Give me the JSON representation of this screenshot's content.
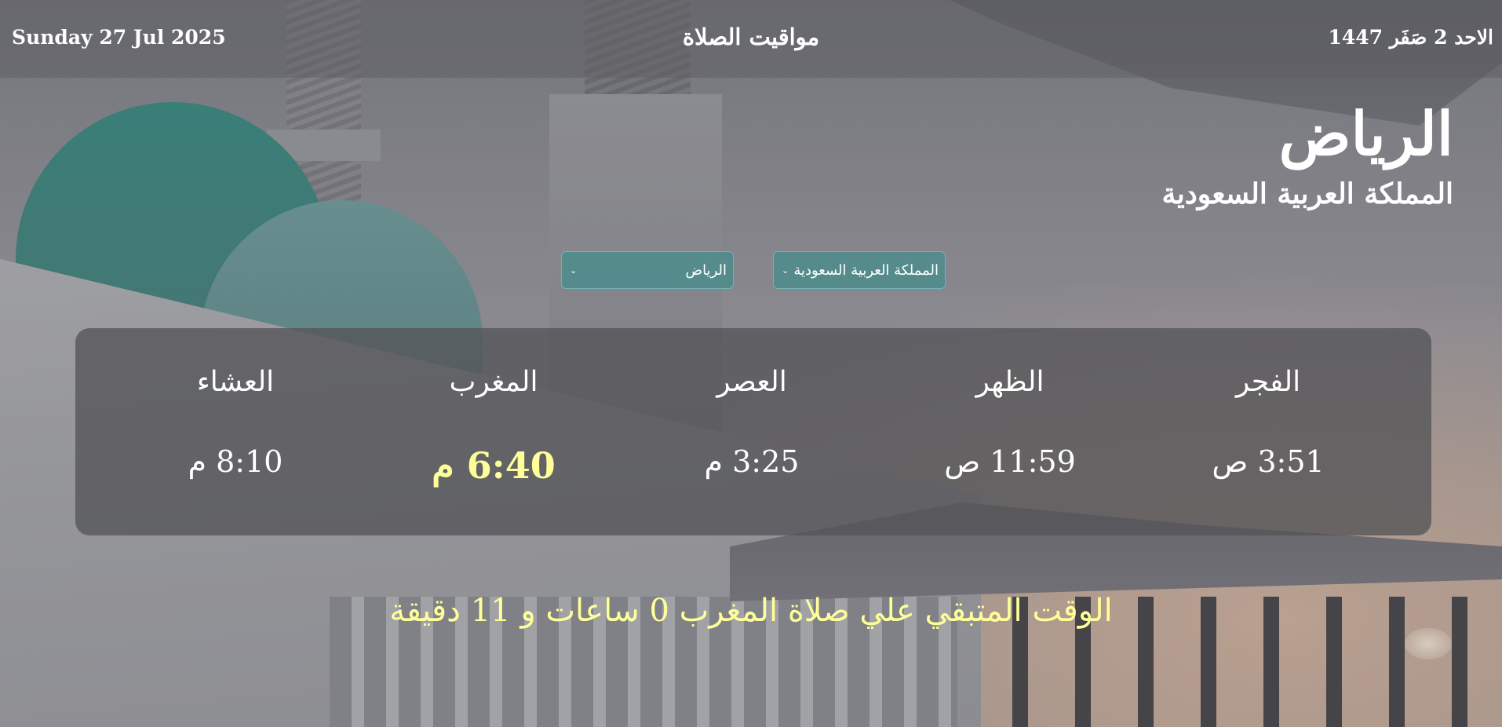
{
  "header": {
    "gregorian_date": "Sunday 27 Jul 2025",
    "title": "مواقيت الصلاة",
    "hijri_date": "الاحد 2 صَفَر 1447"
  },
  "location": {
    "city": "الرياض",
    "country": "المملكة العربية السعودية"
  },
  "selectors": {
    "country_value": "المملكة العربية السعودية",
    "city_value": "الرياض"
  },
  "prayers": [
    {
      "name": "الفجر",
      "time": "3:51 ص"
    },
    {
      "name": "الظهر",
      "time": "11:59 ص"
    },
    {
      "name": "العصر",
      "time": "3:25 م"
    },
    {
      "name": "المغرب",
      "time": "6:40 م",
      "next": true
    },
    {
      "name": "العشاء",
      "time": "8:10 م"
    }
  ],
  "countdown": "الوقت المتبقي علي صلاة المغرب 0 ساعات و 11 دقيقة",
  "colors": {
    "highlight": "#ffff99",
    "selector_bg": "#468c8c",
    "panel_bg": "#555558"
  },
  "icons": {
    "dropdown": "chevron-down-icon"
  }
}
